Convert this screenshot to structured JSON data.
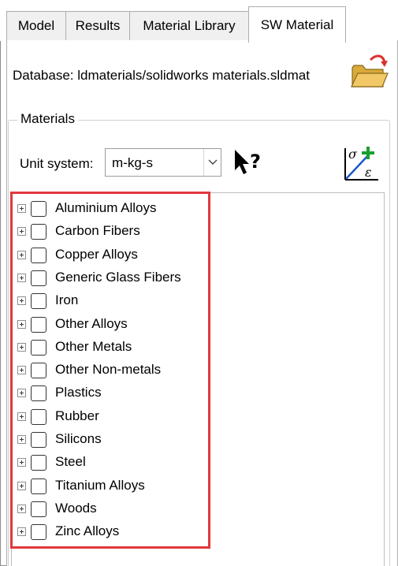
{
  "tabs": [
    {
      "label": "Model"
    },
    {
      "label": "Results"
    },
    {
      "label": "Material Library"
    },
    {
      "label": "SW Material",
      "active": true
    }
  ],
  "database": {
    "label": "Database: ldmaterials/solidworks materials.sldmat",
    "open_icon": "folder-open-icon"
  },
  "materials_group": {
    "title": "Materials",
    "unit_system_label": "Unit system:",
    "unit_system_value": "m-kg-s",
    "help_icon": "context-help-cursor-icon",
    "stress_strain_icon": "stress-strain-icon"
  },
  "tree": {
    "items": [
      {
        "label": "Aluminium Alloys"
      },
      {
        "label": "Carbon Fibers"
      },
      {
        "label": "Copper Alloys"
      },
      {
        "label": "Generic Glass Fibers"
      },
      {
        "label": "Iron"
      },
      {
        "label": "Other Alloys"
      },
      {
        "label": "Other Metals"
      },
      {
        "label": "Other Non-metals"
      },
      {
        "label": "Plastics"
      },
      {
        "label": "Rubber"
      },
      {
        "label": "Silicons"
      },
      {
        "label": "Steel"
      },
      {
        "label": "Titanium Alloys"
      },
      {
        "label": "Woods"
      },
      {
        "label": "Zinc Alloys"
      }
    ]
  },
  "colors": {
    "highlight": "#e0393e",
    "folder": "#f2c766",
    "arrow": "#d8322e",
    "icon_green": "#18a02e",
    "icon_blue": "#1b59c9"
  }
}
